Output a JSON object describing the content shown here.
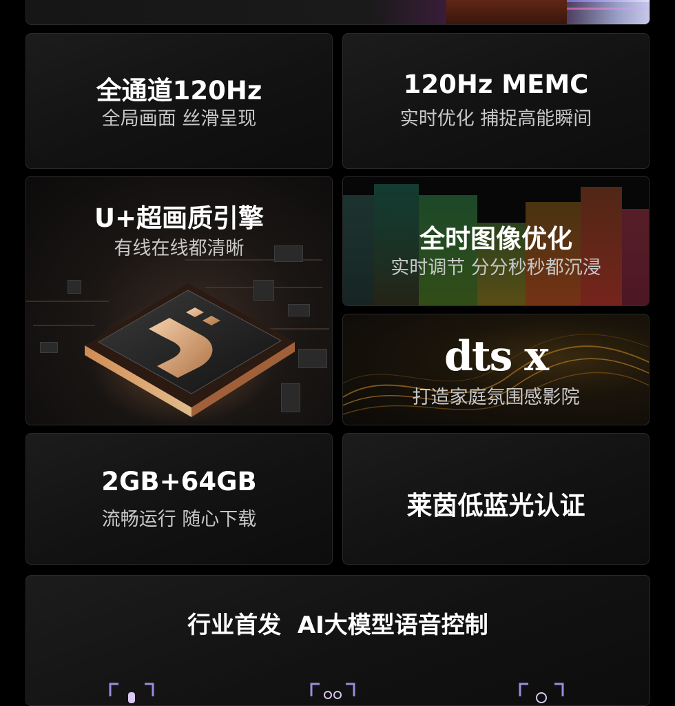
{
  "cards": {
    "refresh": {
      "title": "全通道120Hz",
      "subtitle": "全局画面 丝滑呈现"
    },
    "memc": {
      "title": "120Hz MEMC",
      "subtitle": "实时优化 捕捉高能瞬间"
    },
    "engine": {
      "title": "U+超画质引擎",
      "subtitle": "有线在线都清晰"
    },
    "image_opt": {
      "title": "全时图像优化",
      "subtitle": "实时调节 分分秒秒都沉浸"
    },
    "dts": {
      "logo": "dts x",
      "subtitle": "打造家庭氛围感影院"
    },
    "storage": {
      "title": "2GB+64GB",
      "subtitle": "流畅运行 随心下载"
    },
    "eyecare": {
      "title": "莱茵低蓝光认证"
    },
    "voice": {
      "title": "行业首发  AI大模型语音控制"
    }
  },
  "icons": [
    "chip-logo-icon",
    "mic-bracket-icon",
    "people-bracket-icon",
    "camera-bracket-icon"
  ],
  "colors": {
    "background": "#000000",
    "card": "#151515",
    "border": "#2a2a2a",
    "subtitle": "#c8c8c8",
    "chip_gold": "#d9a57a"
  }
}
